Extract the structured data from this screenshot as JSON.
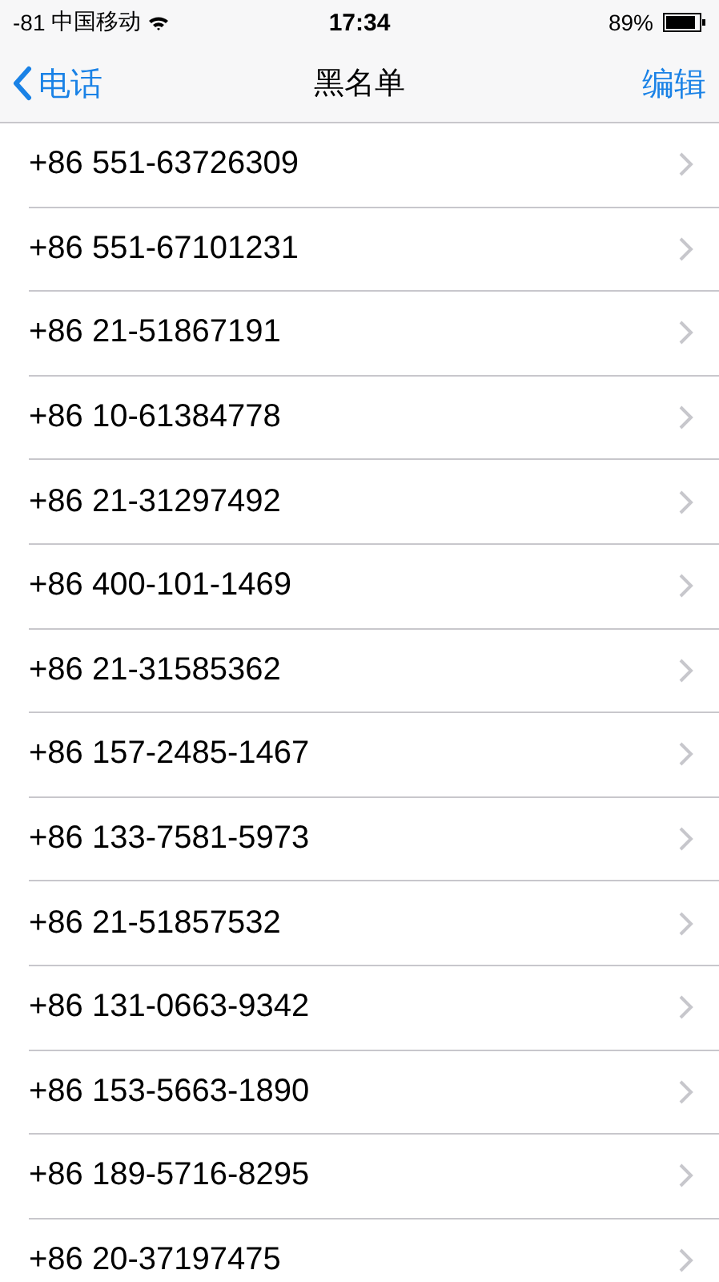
{
  "status_bar": {
    "signal": "-81",
    "carrier": "中国移动",
    "time": "17:34",
    "battery": "89%"
  },
  "nav_bar": {
    "back": "电话",
    "title": "黑名单",
    "action": "编辑"
  },
  "numbers": [
    "+86 551-63726309",
    "+86 551-67101231",
    "+86 21-51867191",
    "+86 10-61384778",
    "+86 21-31297492",
    "+86 400-101-1469",
    "+86 21-31585362",
    "+86 157-2485-1467",
    "+86 133-7581-5973",
    "+86 21-51857532",
    "+86 131-0663-9342",
    "+86 153-5663-1890",
    "+86 189-5716-8295",
    "+86 20-37197475"
  ]
}
